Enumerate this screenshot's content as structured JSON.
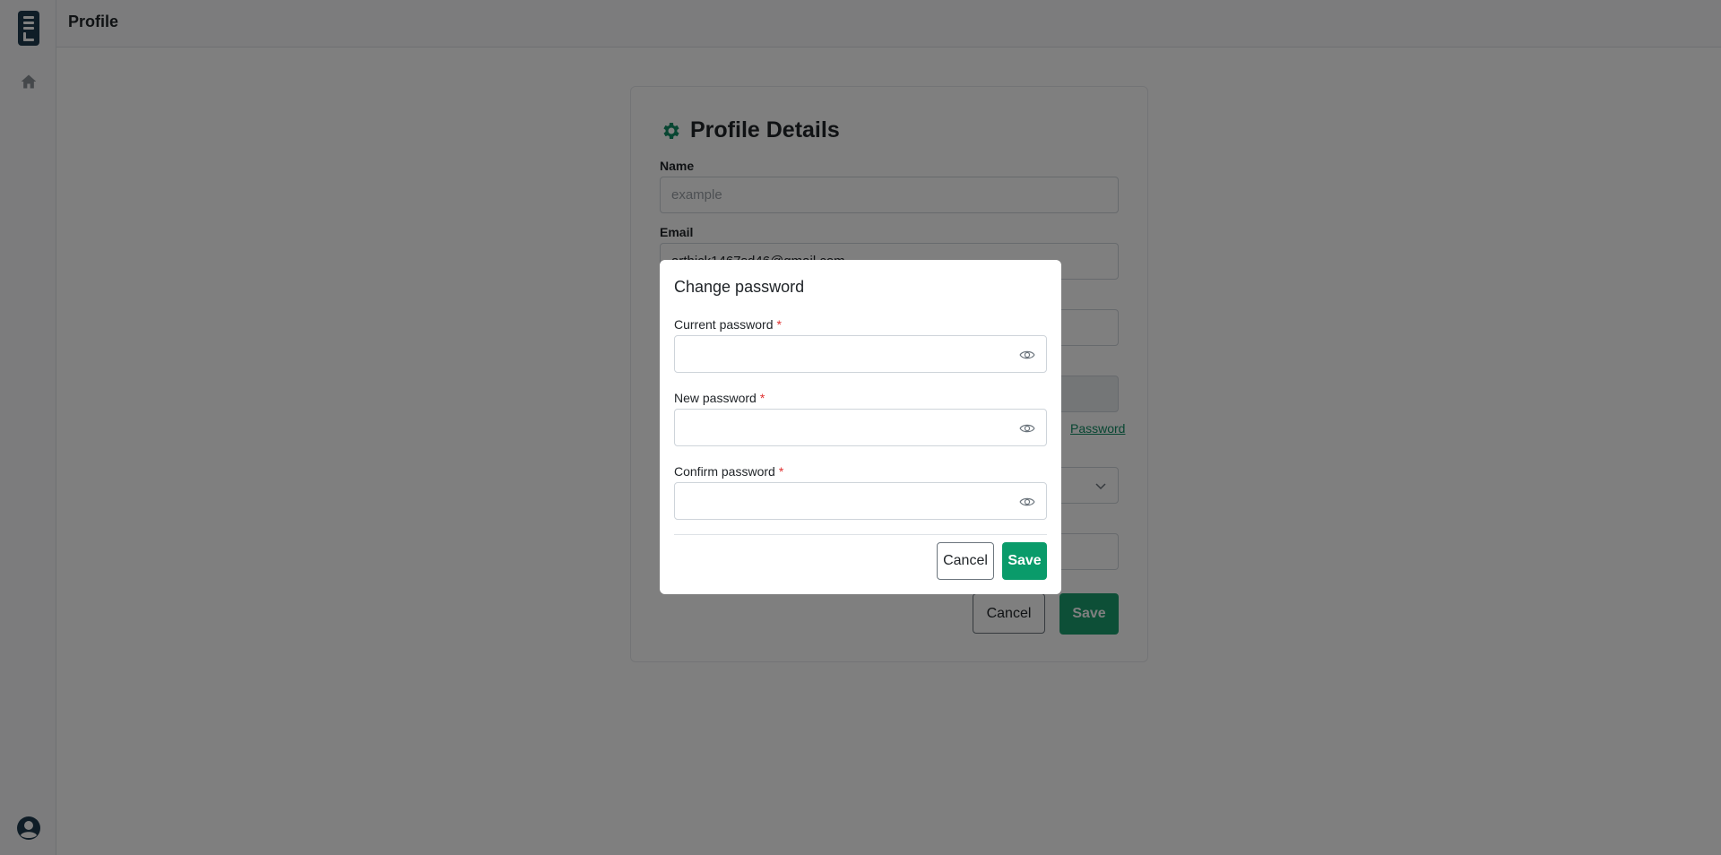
{
  "header": {
    "title": "Profile"
  },
  "profile_card": {
    "title": "Profile Details",
    "name_label": "Name",
    "name_placeholder": "example",
    "email_label": "Email",
    "email_value": "arthick1467sd46@gmail.com",
    "change_password_link": "Password",
    "cancel_label": "Cancel",
    "save_label": "Save"
  },
  "modal": {
    "title": "Change password",
    "fields": [
      {
        "label": "Current password",
        "required_mark": "*",
        "value": ""
      },
      {
        "label": "New password",
        "required_mark": "*",
        "value": ""
      },
      {
        "label": "Confirm password",
        "required_mark": "*",
        "value": ""
      }
    ],
    "cancel_label": "Cancel",
    "save_label": "Save"
  },
  "colors": {
    "accent": "#0a9b6a",
    "required": "#e03131",
    "logo": "#1f3a4f"
  },
  "icons": {
    "logo": "app-logo",
    "nav_home": "home-icon",
    "account": "user-circle-icon",
    "settings": "gear-icon",
    "password_toggle": "eye-icon",
    "select": "chevron-down-icon"
  }
}
